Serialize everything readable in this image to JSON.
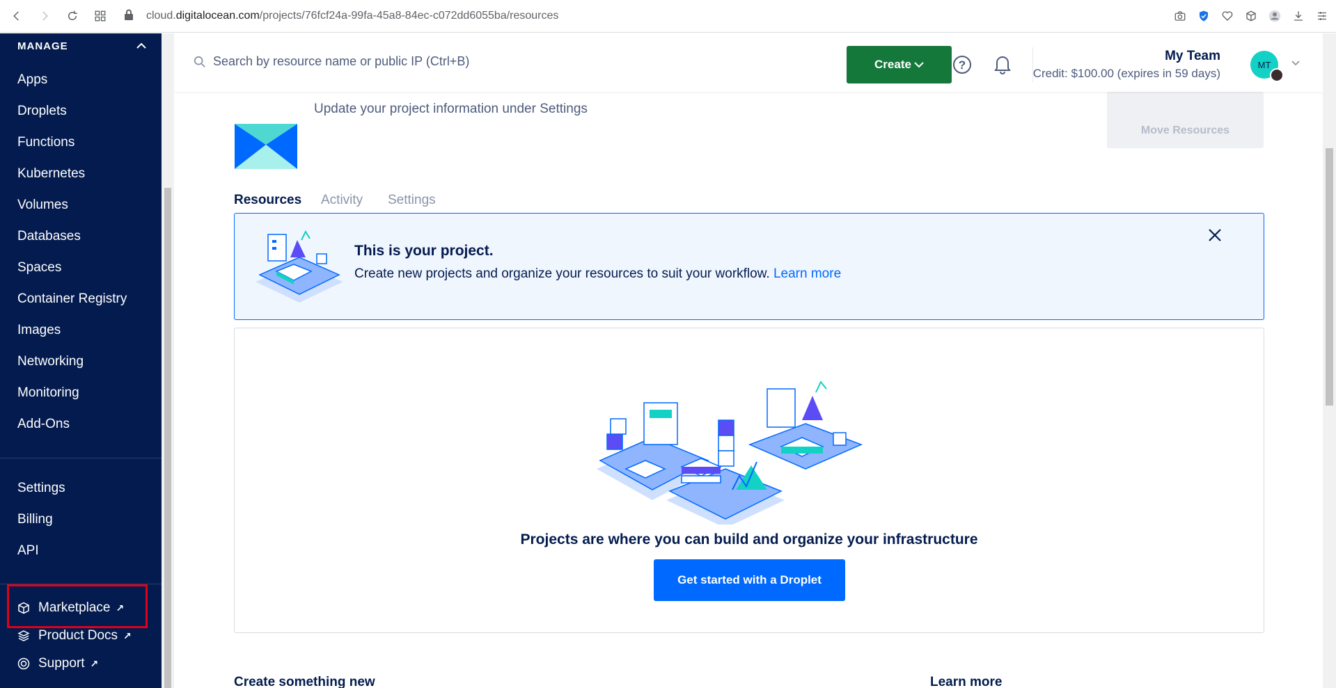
{
  "browser": {
    "url_prefix": "cloud.",
    "url_host": "digitalocean.com",
    "url_path": "/projects/76fcf24a-99fa-45a8-84ec-c072dd6055ba/resources"
  },
  "sidebar": {
    "section_title": "MANAGE",
    "items": [
      {
        "label": "Apps"
      },
      {
        "label": "Droplets"
      },
      {
        "label": "Functions"
      },
      {
        "label": "Kubernetes"
      },
      {
        "label": "Volumes"
      },
      {
        "label": "Databases"
      },
      {
        "label": "Spaces"
      },
      {
        "label": "Container Registry"
      },
      {
        "label": "Images"
      },
      {
        "label": "Networking"
      },
      {
        "label": "Monitoring"
      },
      {
        "label": "Add-Ons"
      }
    ],
    "account_items": [
      {
        "label": "Settings"
      },
      {
        "label": "Billing"
      },
      {
        "label": "API"
      }
    ],
    "external_links": [
      {
        "label": "Marketplace",
        "icon": "cube-icon"
      },
      {
        "label": "Product Docs",
        "icon": "stack-icon"
      },
      {
        "label": "Support",
        "icon": "lifebuoy-icon"
      }
    ]
  },
  "topbar": {
    "search_placeholder": "Search by resource name or public IP (Ctrl+B)",
    "create_label": "Create",
    "team_name": "My Team",
    "credit": "Credit: $100.00 (expires in 59 days)",
    "avatar_initials": "MT"
  },
  "project": {
    "subtitle": "Update your project information under Settings",
    "move_resources_label": "Move Resources"
  },
  "tabs": [
    {
      "label": "Resources",
      "active": true
    },
    {
      "label": "Activity",
      "active": false
    },
    {
      "label": "Settings",
      "active": false
    }
  ],
  "banner": {
    "title": "This is your project.",
    "text": "Create new projects and organize your resources to suit your workflow.",
    "link": "Learn more"
  },
  "empty_state": {
    "title": "Projects are where you can build and organize your infrastructure",
    "cta": "Get started with a Droplet"
  },
  "sections": {
    "create": "Create something new",
    "learn": "Learn more"
  },
  "colors": {
    "sidebar_bg": "#031b4e",
    "create_btn": "#15783b",
    "primary": "#0069ff",
    "highlight": "#e0001a"
  }
}
